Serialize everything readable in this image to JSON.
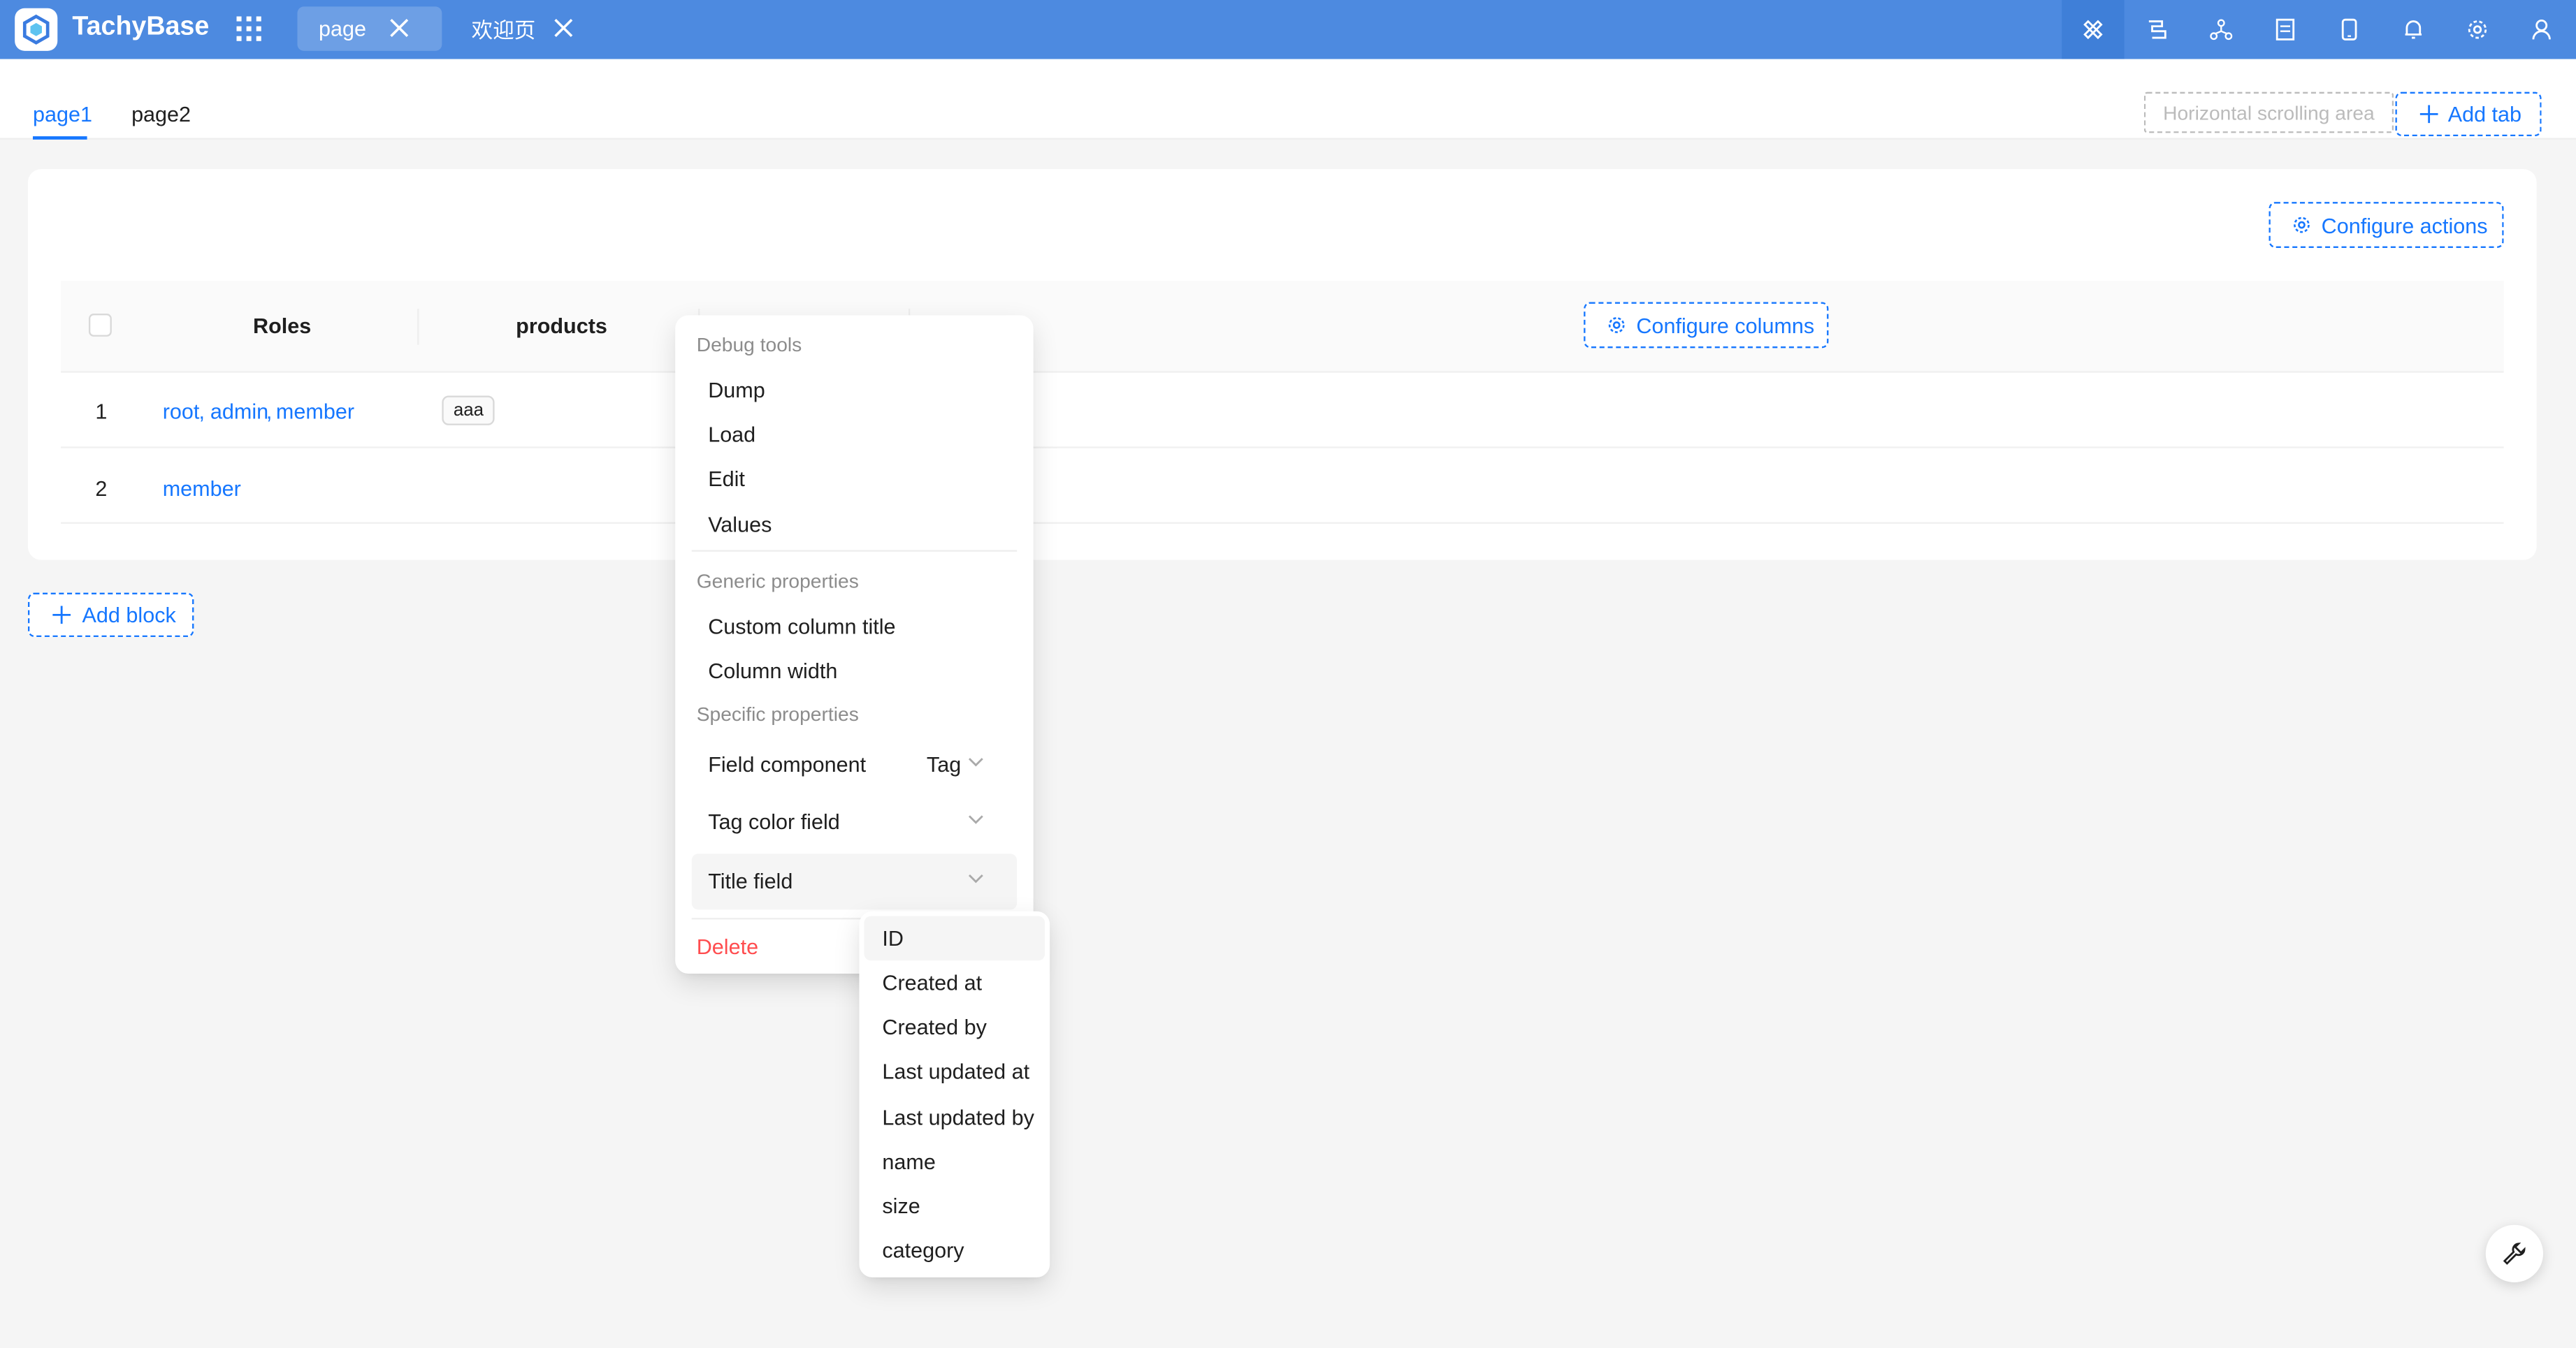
{
  "app": {
    "brand": "TachyBase"
  },
  "top_tabs": [
    {
      "label": "page"
    },
    {
      "label": "欢迎页"
    }
  ],
  "top_icons": [
    "design-mode-icon",
    "workflow-icon",
    "collections-graph-icon",
    "document-icon",
    "mobile-icon",
    "bell-icon",
    "gear-icon",
    "user-icon"
  ],
  "page_tabs": [
    {
      "label": "page1"
    },
    {
      "label": "page2"
    }
  ],
  "subbar": {
    "hscroll_placeholder": "Horizontal scrolling area",
    "add_tab": "Add tab"
  },
  "block": {
    "configure_actions": "Configure actions",
    "configure_columns": "Configure columns",
    "columns": [
      "Roles",
      "products"
    ],
    "rows": [
      {
        "num": "1",
        "roles": [
          "root",
          "admin",
          "member"
        ],
        "products": "aaa"
      },
      {
        "num": "2",
        "roles": [
          "member"
        ],
        "products": ""
      }
    ]
  },
  "add_block": "Add block",
  "menu": {
    "debug_group": "Debug tools",
    "debug_items": [
      "Dump",
      "Load",
      "Edit",
      "Values"
    ],
    "generic_group": "Generic properties",
    "generic_items": [
      "Custom column title",
      "Column width"
    ],
    "specific_group": "Specific properties",
    "field_component": {
      "label": "Field component",
      "value": "Tag"
    },
    "tag_color_field": {
      "label": "Tag color field"
    },
    "title_field": {
      "label": "Title field"
    },
    "delete": "Delete"
  },
  "title_field_options": [
    "ID",
    "Created at",
    "Created by",
    "Last updated at",
    "Last updated by",
    "name",
    "size",
    "category"
  ],
  "colors": {
    "primary": "#1677ff",
    "header": "#4d8ae0",
    "danger": "#ff4d4f"
  }
}
